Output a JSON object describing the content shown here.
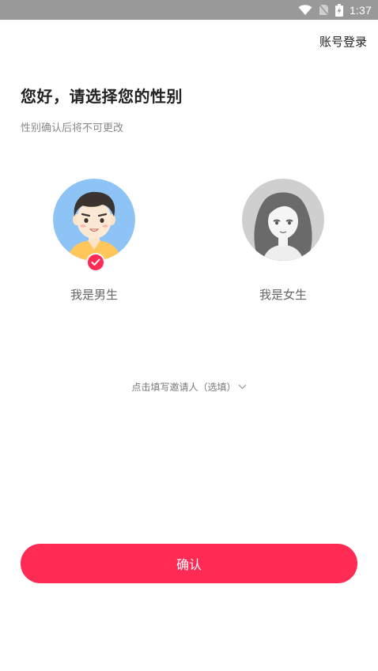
{
  "status_bar": {
    "time": "1:37",
    "icons": [
      "wifi-icon",
      "no-sim-icon",
      "battery-charging-icon"
    ]
  },
  "header": {
    "account_login_label": "账号登录"
  },
  "main": {
    "title": "您好，请选择您的性别",
    "subtitle": "性别确认后将不可更改",
    "options": [
      {
        "label": "我是男生",
        "selected": true,
        "avatar_icon": "male-avatar-icon"
      },
      {
        "label": "我是女生",
        "selected": false,
        "avatar_icon": "female-avatar-icon"
      }
    ],
    "inviter_label": "点击填写邀请人（选填）",
    "confirm_label": "确认"
  },
  "colors": {
    "accent": "#ff2b55",
    "status_bar": "#999999",
    "male_avatar_bg": "#8ec4f5",
    "female_avatar_bg": "#cfcfcf"
  }
}
